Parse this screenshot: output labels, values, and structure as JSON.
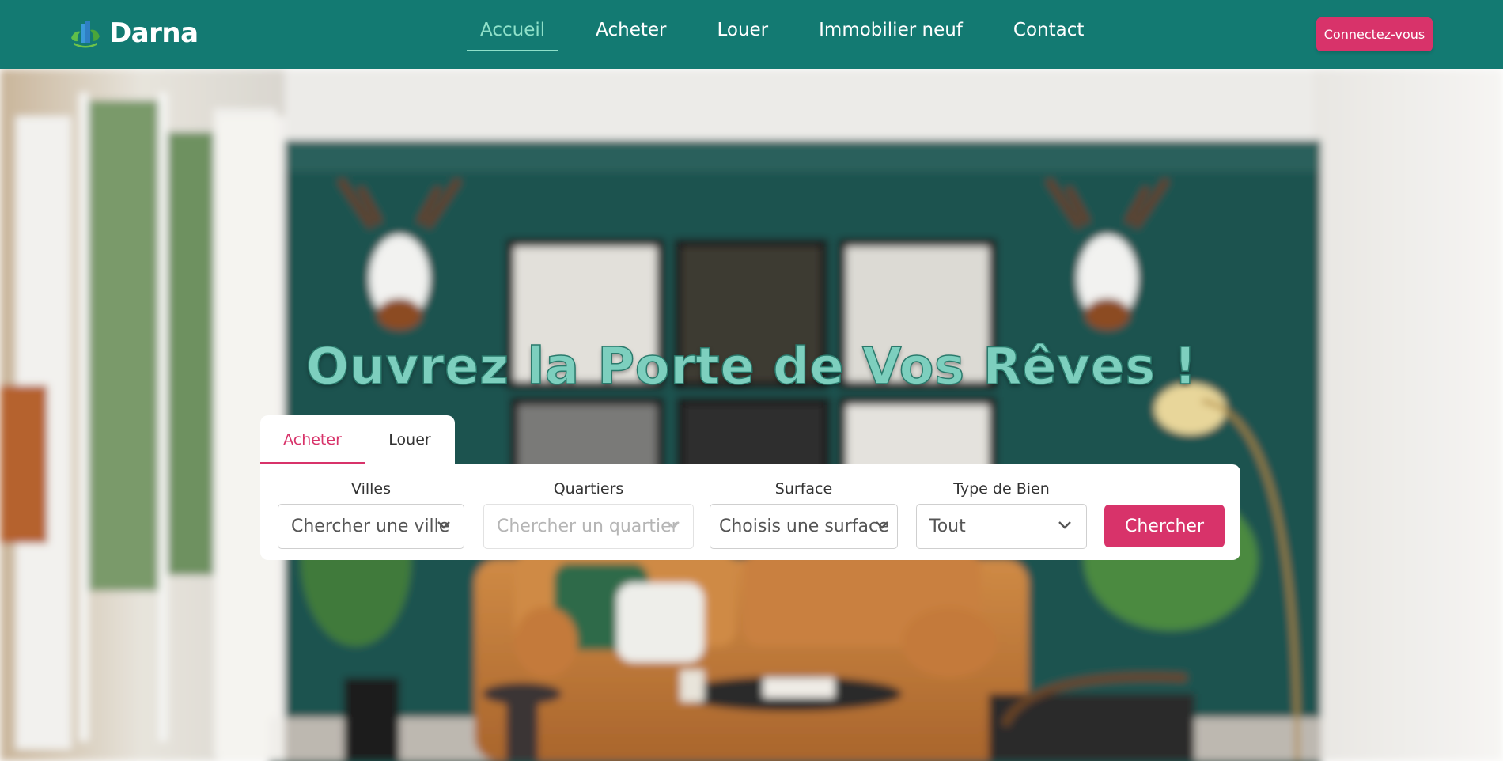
{
  "brand": {
    "name": "Darna"
  },
  "nav": {
    "items": [
      {
        "label": "Accueil",
        "active": true
      },
      {
        "label": "Acheter",
        "active": false
      },
      {
        "label": "Louer",
        "active": false
      },
      {
        "label": "Immobilier neuf",
        "active": false
      },
      {
        "label": "Contact",
        "active": false
      }
    ],
    "login_label": "Connectez-vous"
  },
  "hero": {
    "title": "Ouvrez la Porte de Vos Rêves !"
  },
  "search": {
    "tabs": [
      {
        "label": "Acheter",
        "active": true
      },
      {
        "label": "Louer",
        "active": false
      }
    ],
    "fields": [
      {
        "label": "Villes",
        "value": "Chercher une ville",
        "disabled": false
      },
      {
        "label": "Quartiers",
        "value": "Chercher un quartier",
        "disabled": true
      },
      {
        "label": "Surface",
        "value": "Choisis une surface",
        "disabled": false
      },
      {
        "label": "Type de Bien",
        "value": "Tout",
        "disabled": false
      }
    ],
    "submit_label": "Chercher"
  },
  "colors": {
    "header": "#137a72",
    "accent": "#d8336a",
    "active_nav": "#8fe0c9",
    "hero_title": "#7dcfbe"
  },
  "icons": [
    "building-leaf-logo-icon",
    "chevron-down-icon"
  ]
}
